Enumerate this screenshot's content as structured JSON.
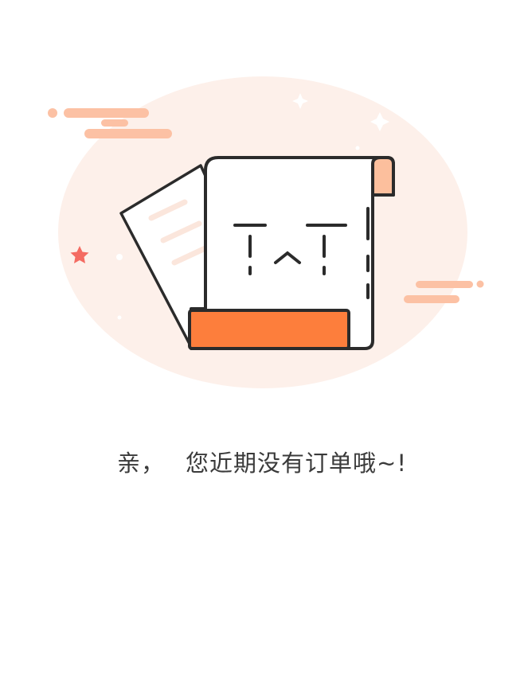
{
  "empty_state": {
    "message_prefix": "亲，",
    "message_body": "您近期没有订单哦~!"
  },
  "illustration": {
    "icon": "empty-orders-document-icon",
    "face": "crying-face",
    "colors": {
      "background_circle": "#fdf0ea",
      "accent_orange": "#fd7e3c",
      "light_orange": "#fcbf9d",
      "star_red": "#f46b62",
      "outline": "#2b2b2b"
    }
  }
}
